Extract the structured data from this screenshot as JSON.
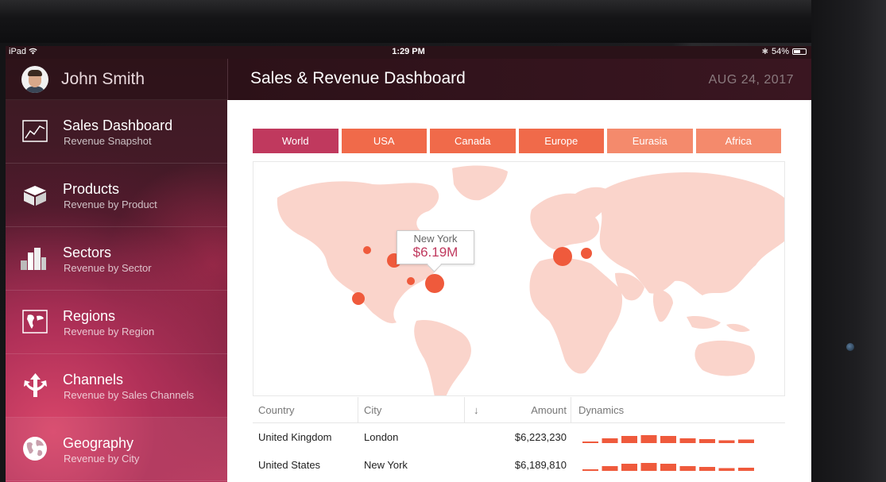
{
  "status_bar": {
    "device": "iPad",
    "time": "1:29 PM",
    "battery": "54%",
    "battery_level": 0.54
  },
  "user": {
    "name": "John Smith"
  },
  "header": {
    "title": "Sales & Revenue Dashboard",
    "date": "AUG 24, 2017"
  },
  "nav": [
    {
      "title": "Sales Dashboard",
      "subtitle": "Revenue Snapshot",
      "icon": "line-chart-icon"
    },
    {
      "title": "Products",
      "subtitle": "Revenue by Product",
      "icon": "box-icon"
    },
    {
      "title": "Sectors",
      "subtitle": "Revenue by Sector",
      "icon": "buildings-icon"
    },
    {
      "title": "Regions",
      "subtitle": "Revenue by Region",
      "icon": "map-icon"
    },
    {
      "title": "Channels",
      "subtitle": "Revenue by Sales Channels",
      "icon": "split-arrows-icon"
    },
    {
      "title": "Geography",
      "subtitle": "Revenue by City",
      "icon": "globe-icon"
    }
  ],
  "tabs": [
    {
      "label": "World",
      "color": "#c0395e"
    },
    {
      "label": "USA",
      "color": "#f06a4a"
    },
    {
      "label": "Canada",
      "color": "#f06a4a"
    },
    {
      "label": "Europe",
      "color": "#f06a4a"
    },
    {
      "label": "Eurasia",
      "color": "#f48a6c"
    },
    {
      "label": "Africa",
      "color": "#f48a6c"
    }
  ],
  "map": {
    "tooltip_city": "New York",
    "tooltip_value": "$6.19M",
    "land_color": "#fad4cb",
    "marker_color": "#ef5a3c"
  },
  "table": {
    "headers": [
      "Country",
      "City",
      "↓",
      "Amount",
      "Dynamics"
    ],
    "rows": [
      {
        "country": "United Kingdom",
        "city": "London",
        "amount": "$6,223,230"
      },
      {
        "country": "United States",
        "city": "New York",
        "amount": "$6,189,810"
      }
    ],
    "bar_color": "#ef5a3c"
  }
}
